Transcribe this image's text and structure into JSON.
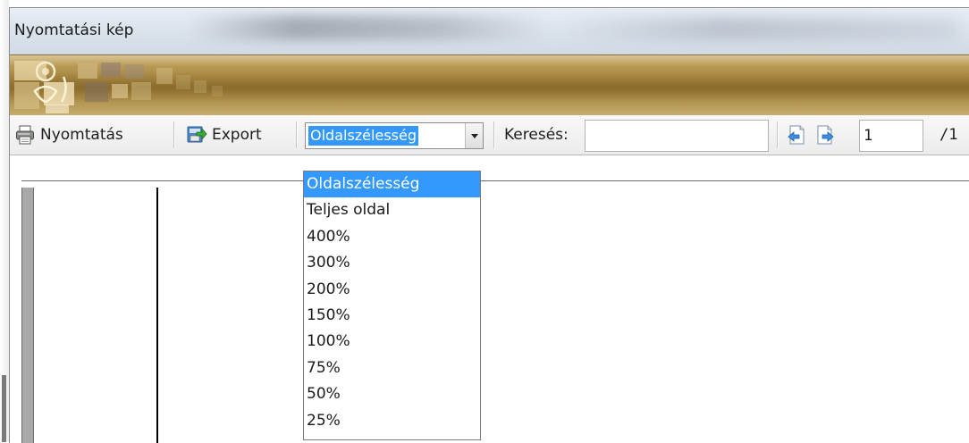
{
  "window": {
    "title": "Nyomtatási kép"
  },
  "toolbar": {
    "print_label": "Nyomtatás",
    "export_label": "Export",
    "zoom_value": "Oldalszélesség",
    "search_label": "Keresés:",
    "search_value": "",
    "page_current": "1",
    "page_total": "/1"
  },
  "zoom_options": [
    "Oldalszélesség",
    "Teljes oldal",
    "400%",
    "300%",
    "200%",
    "150%",
    "100%",
    "75%",
    "50%",
    "25%"
  ],
  "colors": {
    "selection": "#3399ff",
    "banner_gold": "#9a7a34"
  },
  "icons": {
    "print": "printer-icon",
    "export": "export-icon",
    "prev_page": "previous-page-icon",
    "next_page": "next-page-icon",
    "dropdown": "chevron-down-icon"
  }
}
